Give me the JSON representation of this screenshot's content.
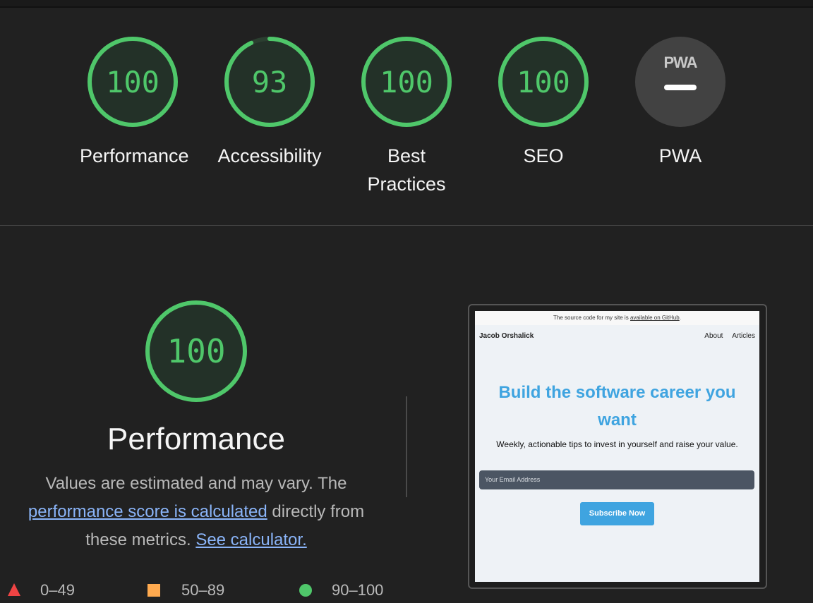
{
  "colors": {
    "pass": "#4fc76a",
    "pass_bg": "#233128",
    "average": "#ffaa4f",
    "fail": "#ef4444",
    "link": "#8ab4f8",
    "pwa_bg": "#424242",
    "accent_blue": "#3fa4e0"
  },
  "gauges": [
    {
      "score": "100",
      "value": 100,
      "label": "Performance"
    },
    {
      "score": "93",
      "value": 93,
      "label": "Accessibility"
    },
    {
      "score": "100",
      "value": 100,
      "label_line1": "Best",
      "label_line2": "Practices"
    },
    {
      "score": "100",
      "value": 100,
      "label": "SEO"
    },
    {
      "score": "PWA",
      "label": "PWA",
      "icon": "pwa-dash-icon"
    }
  ],
  "performance": {
    "score": "100",
    "value": 100,
    "title": "Performance",
    "desc_text1": "Values are estimated and may vary. The",
    "desc_link1": "performance score is calculated",
    "desc_text2": "directly from these metrics.",
    "desc_link2": "See calculator."
  },
  "legend": [
    {
      "icon": "triangle-icon",
      "range": "0–49"
    },
    {
      "icon": "square-icon",
      "range": "50–89"
    },
    {
      "icon": "circle-icon",
      "range": "90–100"
    }
  ],
  "screenshot": {
    "banner_text": "The source code for my site is",
    "banner_link": "available on GitHub",
    "banner_end": ".",
    "brand": "Jacob Orshalick",
    "nav_links": [
      "About",
      "Articles"
    ],
    "headline_line1": "Build the software career you",
    "headline_line2": "want",
    "subhead": "Weekly, actionable tips to invest in yourself and raise your value.",
    "email_placeholder": "Your Email Address",
    "subscribe_label": "Subscribe Now"
  }
}
